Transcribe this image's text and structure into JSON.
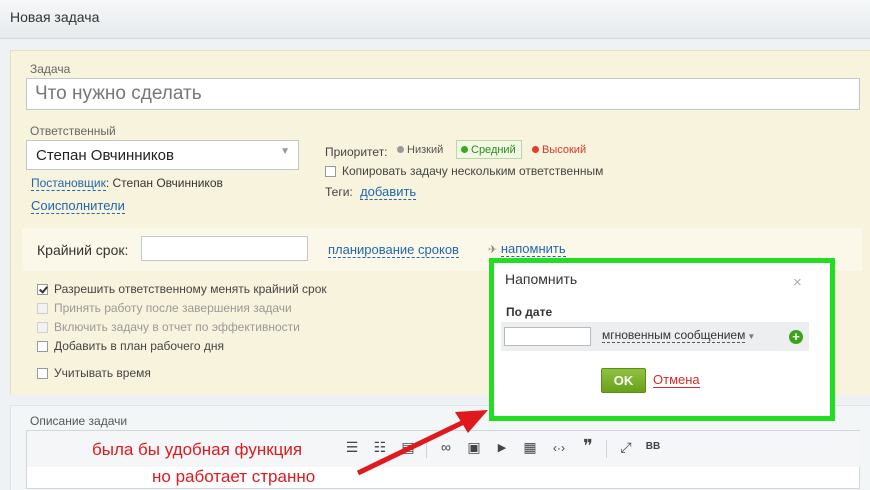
{
  "window": {
    "title": "Новая задача"
  },
  "task": {
    "label": "Задача",
    "placeholder": "Что нужно сделать"
  },
  "responsible": {
    "label": "Ответственный",
    "value": "Степан Овчинников",
    "creator_link": "Постановщик",
    "creator_value": ": Степан Овчинников",
    "coexecutors_link": "Соисполнители"
  },
  "priority": {
    "label": "Приоритет:",
    "options": [
      {
        "label": "Низкий",
        "color": "#9a9a9a"
      },
      {
        "label": "Средний",
        "color": "#3aaa1c"
      },
      {
        "label": "Высокий",
        "color": "#e63c2f"
      }
    ]
  },
  "copy_task": {
    "label": "Копировать задачу нескольким ответственным",
    "checked": false
  },
  "tags": {
    "label": "Теги:",
    "add_link": "добавить"
  },
  "deadline": {
    "label": "Крайний срок:",
    "value": "",
    "planning_link": "планирование сроков",
    "remind_link": "напомнить"
  },
  "options": [
    {
      "label": "Разрешить ответственному менять крайний срок",
      "checked": true,
      "disabled": false
    },
    {
      "label": "Принять работу после завершения задачи",
      "checked": false,
      "disabled": true
    },
    {
      "label": "Включить задачу в отчет по эффективности",
      "checked": false,
      "disabled": true
    },
    {
      "label": "Добавить в план рабочего дня",
      "checked": false,
      "disabled": false
    },
    {
      "label": "Учитывать время",
      "checked": false,
      "disabled": false
    }
  ],
  "description": {
    "label": "Описание задачи"
  },
  "editor_toolbar": [
    {
      "icon": "numbered-list-icon",
      "glyph": "☰"
    },
    {
      "icon": "bullet-list-icon",
      "glyph": "☷"
    },
    {
      "icon": "align-icon",
      "glyph": "▤"
    },
    {
      "icon": "link-icon",
      "glyph": "∞"
    },
    {
      "icon": "image-icon",
      "glyph": "▣"
    },
    {
      "icon": "video-icon",
      "glyph": "▶"
    },
    {
      "icon": "table-icon",
      "glyph": "▦"
    },
    {
      "icon": "code-icon",
      "glyph": "‹·›"
    },
    {
      "icon": "quote-icon",
      "glyph": "❞"
    },
    {
      "icon": "fullscreen-icon",
      "glyph": "⤢"
    },
    {
      "icon": "bbcode-icon",
      "glyph": "BB"
    }
  ],
  "popup": {
    "title": "Напомнить",
    "close_glyph": "×",
    "section_label": "По дате",
    "date_value": "",
    "method_link": "мгновенным сообщением",
    "add_glyph": "+",
    "ok_label": "OK",
    "cancel_label": "Отмена",
    "border_color": "#22dd22"
  },
  "annotation": {
    "line1": "была бы удобная функция",
    "line2": "но работает странно",
    "color": "#e0191e"
  }
}
